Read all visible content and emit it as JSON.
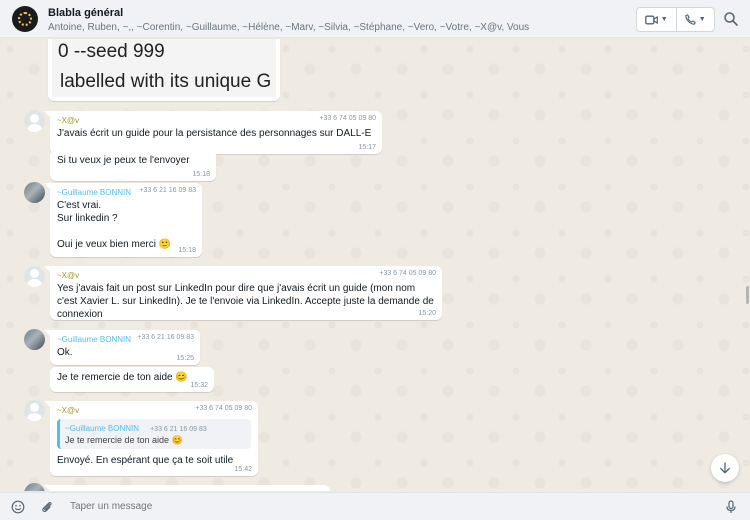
{
  "header": {
    "title": "Blabla général",
    "members": "Antoine, Ruben, ~,, ~Corentin, ~Guillaume, ~Hélène, ~Marv, ~Silvia, ~Stéphane, ~Vero, ~Votre, ~X@v, Vous"
  },
  "image_message": {
    "line1": "0 --seed 999",
    "line2": "labelled with its unique G"
  },
  "messages": [
    {
      "author": "~X@v",
      "author_color": "#a5962c",
      "phone": "+33 6 74 05 09 80",
      "text": "J'avais écrit un guide pour la persistance des personnages sur DALL-E",
      "time": "15:17"
    },
    {
      "text": "Si tu veux je peux te l'envoyer",
      "time": "15:18"
    },
    {
      "author": "~Guillaume BONNIN",
      "author_color": "#53bdeb",
      "phone": "+33 6 21 16 09 83",
      "text": "C'est vrai.\nSur linkedin ?\n\nOui je veux bien merci 🙂",
      "time": "15:18"
    },
    {
      "author": "~X@v",
      "author_color": "#a5962c",
      "phone": "+33 6 74 05 09 80",
      "text": "Yes j'avais fait un post sur LinkedIn pour dire que j'avais écrit un guide (mon nom c'est Xavier L. sur LinkedIn). Je te l'envoie via LinkedIn. Accepte juste la demande de connexion",
      "time": "15:20"
    },
    {
      "author": "~Guillaume BONNIN",
      "author_color": "#53bdeb",
      "phone": "+33 6 21 16 09 83",
      "text": "Ok.",
      "time": "15:25"
    },
    {
      "text": "Je te remercie de ton aide 😊",
      "time": "15:32"
    },
    {
      "author": "~X@v",
      "author_color": "#a5962c",
      "phone": "+33 6 74 05 09 80",
      "quote": {
        "author": "~Guillaume BONNIN",
        "phone": "+33 6 21 16 09 83",
        "text": "Je te remercie de ton aide 😊"
      },
      "text": "Envoyé. En espérant que ça te soit utile",
      "time": "15:42"
    }
  ],
  "composer": {
    "placeholder": "Taper un message"
  },
  "colors": {
    "header_bg": "#f0f2f5",
    "chat_bg": "#efeae2",
    "accent_blue": "#53bdeb"
  },
  "icons": [
    "video-call-icon",
    "voice-call-icon",
    "search-icon",
    "emoji-icon",
    "attach-icon",
    "microphone-icon",
    "scroll-down-icon"
  ]
}
